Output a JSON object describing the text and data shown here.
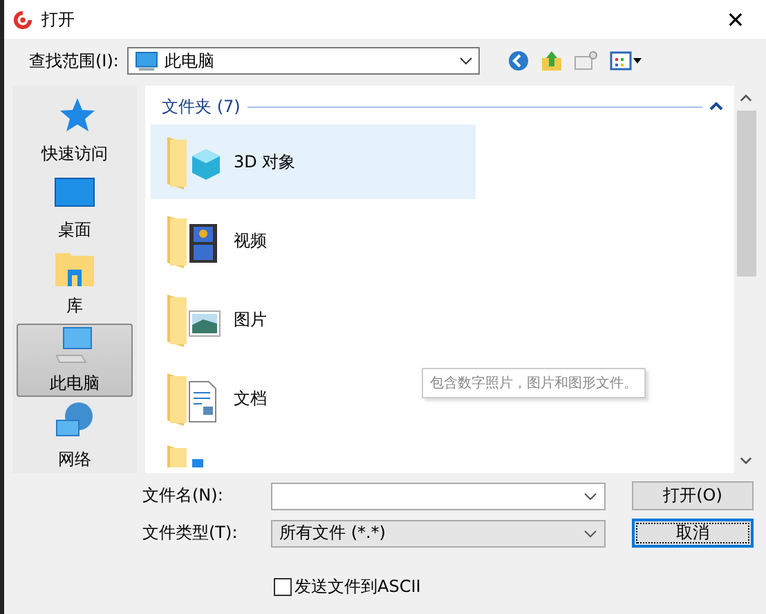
{
  "window": {
    "title": "打开",
    "close": "✕"
  },
  "lookin": {
    "label": "查找范围(I):",
    "value": "此电脑"
  },
  "places": [
    {
      "label": "快速访问",
      "kind": "star",
      "selected": false
    },
    {
      "label": "桌面",
      "kind": "desktop",
      "selected": false
    },
    {
      "label": "库",
      "kind": "library",
      "selected": false
    },
    {
      "label": "此电脑",
      "kind": "computer",
      "selected": true
    },
    {
      "label": "网络",
      "kind": "network",
      "selected": false
    }
  ],
  "group": {
    "title": "文件夹 (7)",
    "expanded": true
  },
  "folders": [
    {
      "name": "3D 对象",
      "kind": "cube",
      "selected": true
    },
    {
      "name": "视频",
      "kind": "video",
      "selected": false
    },
    {
      "name": "图片",
      "kind": "image",
      "selected": false
    },
    {
      "name": "文档",
      "kind": "document",
      "selected": false
    },
    {
      "kind": "download",
      "selected": false
    }
  ],
  "tooltip": "包含数字照片，图片和图形文件。",
  "filename": {
    "label": "文件名(N):"
  },
  "filetype": {
    "label": "文件类型(T):",
    "value": "所有文件 (*.*)"
  },
  "buttons": [
    {
      "label": "打开(O)",
      "focused": false
    },
    {
      "label": "取消",
      "focused": true
    }
  ],
  "ascii": {
    "label": "发送文件到ASCII",
    "checked": false
  }
}
